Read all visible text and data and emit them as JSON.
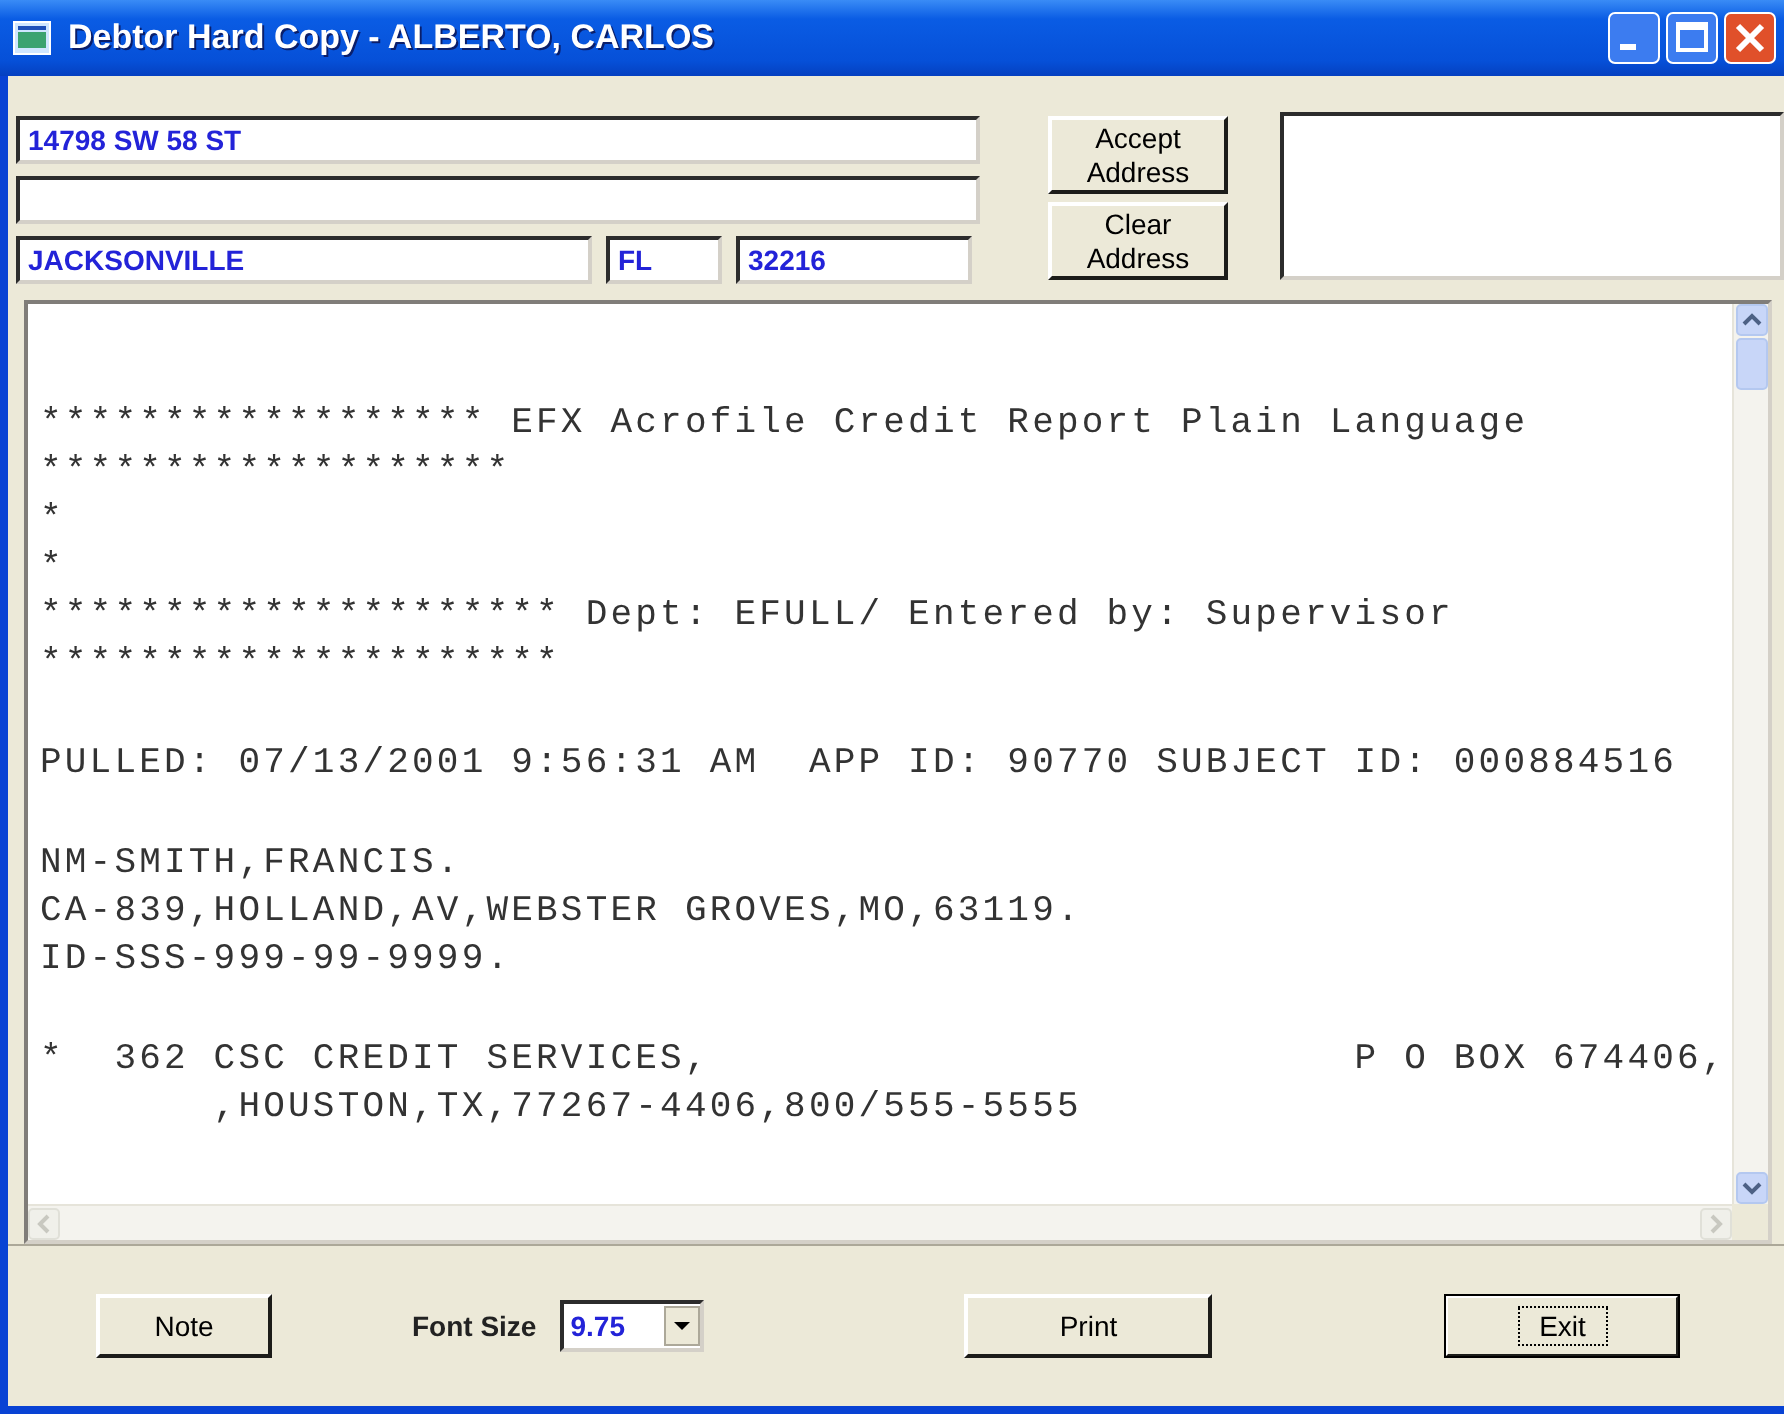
{
  "window": {
    "title": "Debtor Hard Copy - ALBERTO, CARLOS"
  },
  "address": {
    "line_1": "14798 SW 58 ST",
    "city": "JACKSONVILLE",
    "state": "FL",
    "zip": "32216"
  },
  "address_buttons": [
    {
      "label": "Accept Address"
    },
    {
      "label": "Clear Address"
    }
  ],
  "report": {
    "blocks": [
      {
        "lines": [
          "****************** EFX Acrofile Credit Report Plain Language",
          "*******************",
          "*",
          "*",
          "********************* Dept: EFULL/ Entered by: Supervisor",
          "*********************"
        ]
      },
      {
        "lines": [
          "PULLED: 07/13/2001 9:56:31 AM  APP ID: 90770 SUBJECT ID: 000884516"
        ]
      },
      {
        "lines": [
          "NM-SMITH,FRANCIS.",
          "CA-839,HOLLAND,AV,WEBSTER GROVES,MO,63119.",
          "ID-SSS-999-99-9999."
        ]
      },
      {
        "lines": [
          "*  362 CSC CREDIT SERVICES,                          P O BOX 674406,",
          "       ,HOUSTON,TX,77267-4406,800/555-5555"
        ]
      }
    ]
  },
  "footer": {
    "note_button": "Note",
    "font_size_label": "Font Size",
    "font_size": "9.75",
    "print_button": "Print",
    "exit_button": "Exit"
  }
}
